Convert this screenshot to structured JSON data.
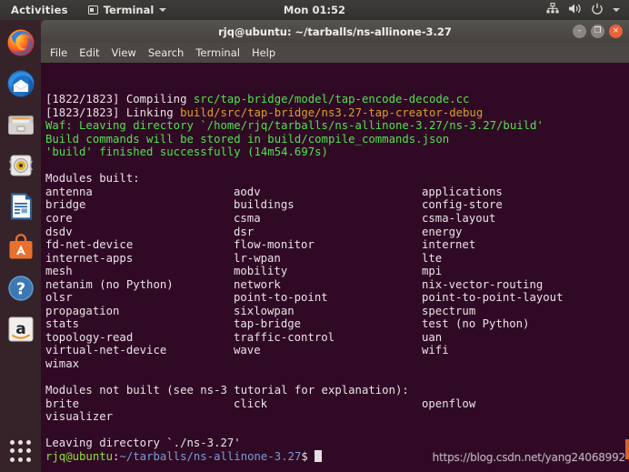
{
  "topbar": {
    "activities": "Activities",
    "app_name": "Terminal",
    "clock": "Mon 01:52",
    "icons": {
      "app_window": "window-icon",
      "app_caret": "chevron-down-icon",
      "network": "network-icon",
      "volume": "volume-icon",
      "power": "power-icon",
      "menu_caret": "chevron-down-icon"
    }
  },
  "dock": {
    "items": [
      {
        "name": "firefox",
        "label": "Firefox"
      },
      {
        "name": "thunderbird",
        "label": "Thunderbird Mail"
      },
      {
        "name": "files",
        "label": "Files"
      },
      {
        "name": "rhythmbox",
        "label": "Rhythmbox"
      },
      {
        "name": "libreoffice-writer",
        "label": "LibreOffice Writer"
      },
      {
        "name": "ubuntu-software",
        "label": "Ubuntu Software"
      },
      {
        "name": "help",
        "label": "Help"
      },
      {
        "name": "amazon",
        "label": "Amazon"
      }
    ],
    "show_apps_label": "Show Applications"
  },
  "window": {
    "title": "rjq@ubuntu: ~/tarballs/ns-allinone-3.27",
    "buttons": {
      "minimize": "–",
      "maximize": "❐",
      "close": "×"
    },
    "menu": [
      "File",
      "Edit",
      "View",
      "Search",
      "Terminal",
      "Help"
    ]
  },
  "terminal": {
    "build_lines": [
      {
        "prefix": "[1822/1823] Compiling ",
        "path": "src/tap-bridge/model/tap-encode-decode.cc",
        "path_color": "green"
      },
      {
        "prefix": "[1823/1823] Linking ",
        "path": "build/src/tap-bridge/ns3.27-tap-creator-debug",
        "path_color": "yellow"
      }
    ],
    "waf_lines": [
      "Waf: Leaving directory `/home/rjq/tarballs/ns-allinone-3.27/ns-3.27/build'",
      "Build commands will be stored in build/compile_commands.json",
      "'build' finished successfully (14m54.697s)"
    ],
    "built_header": "Modules built:",
    "modules_built": [
      [
        "antenna",
        "aodv",
        "applications"
      ],
      [
        "bridge",
        "buildings",
        "config-store"
      ],
      [
        "core",
        "csma",
        "csma-layout"
      ],
      [
        "dsdv",
        "dsr",
        "energy"
      ],
      [
        "fd-net-device",
        "flow-monitor",
        "internet"
      ],
      [
        "internet-apps",
        "lr-wpan",
        "lte"
      ],
      [
        "mesh",
        "mobility",
        "mpi"
      ],
      [
        "netanim (no Python)",
        "network",
        "nix-vector-routing"
      ],
      [
        "olsr",
        "point-to-point",
        "point-to-point-layout"
      ],
      [
        "propagation",
        "sixlowpan",
        "spectrum"
      ],
      [
        "stats",
        "tap-bridge",
        "test (no Python)"
      ],
      [
        "topology-read",
        "traffic-control",
        "uan"
      ],
      [
        "virtual-net-device",
        "wave",
        "wifi"
      ],
      [
        "wimax",
        "",
        ""
      ]
    ],
    "not_built_header": "Modules not built (see ns-3 tutorial for explanation):",
    "modules_not_built": [
      [
        "brite",
        "click",
        "openflow"
      ],
      [
        "visualizer",
        "",
        ""
      ]
    ],
    "leaving_line": "Leaving directory `./ns-3.27'",
    "prompt_user": "rjq@ubuntu",
    "prompt_sep": ":",
    "prompt_path": "~/tarballs/ns-allinone-3.27",
    "prompt_dollar": "$ "
  },
  "watermark": "https://blog.csdn.net/yang24068992",
  "colors": {
    "terminal_bg": "#300a24",
    "dock_bg": "#36232a",
    "topbar_bg": "#3d3c39",
    "accent_close": "#e8623a",
    "path_green": "#4ee24e",
    "path_yellow": "#d8a227",
    "prompt_green": "#8ae234",
    "prompt_blue": "#7b9cd8"
  }
}
